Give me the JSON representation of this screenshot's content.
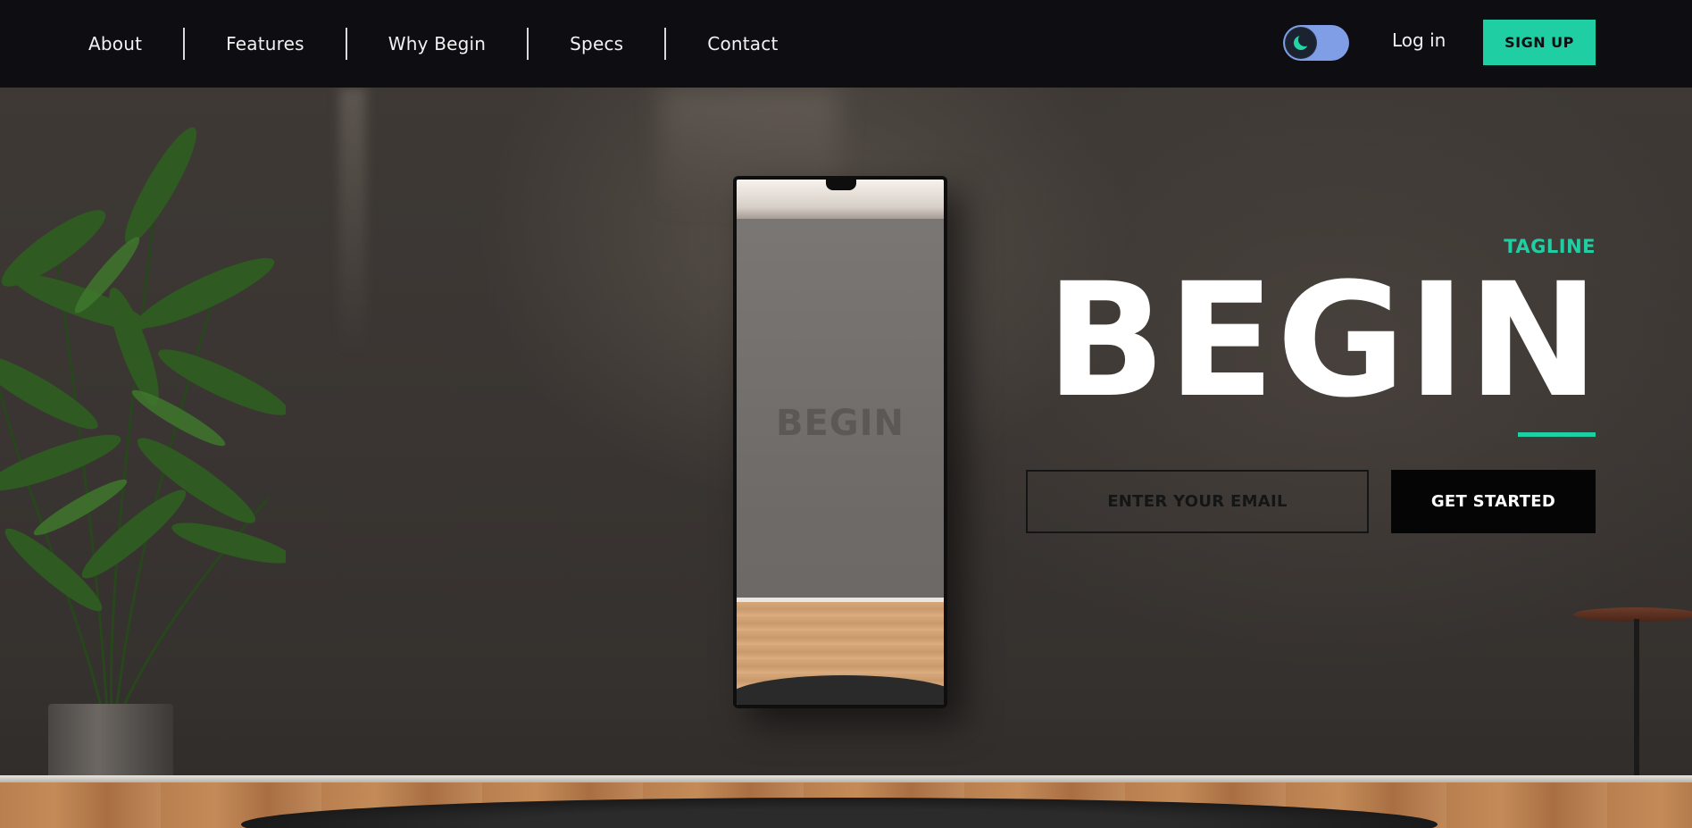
{
  "nav": {
    "links": [
      {
        "label": "About"
      },
      {
        "label": "Features"
      },
      {
        "label": "Why Begin"
      },
      {
        "label": "Specs"
      },
      {
        "label": "Contact"
      }
    ],
    "theme_toggle": {
      "icon": "moon-icon",
      "state": "dark"
    },
    "login_label": "Log in",
    "signup_label": "SIGN UP"
  },
  "hero": {
    "tagline": "TAGLINE",
    "headline": "BEGIN",
    "mirror_brand": "BEGIN",
    "email_placeholder": "ENTER YOUR EMAIL",
    "cta_label": "GET STARTED"
  },
  "colors": {
    "accent": "#1fcfa3",
    "nav_bg": "#0d0d12",
    "toggle_bg": "#7f9ee6",
    "cta_bg": "#050505"
  }
}
